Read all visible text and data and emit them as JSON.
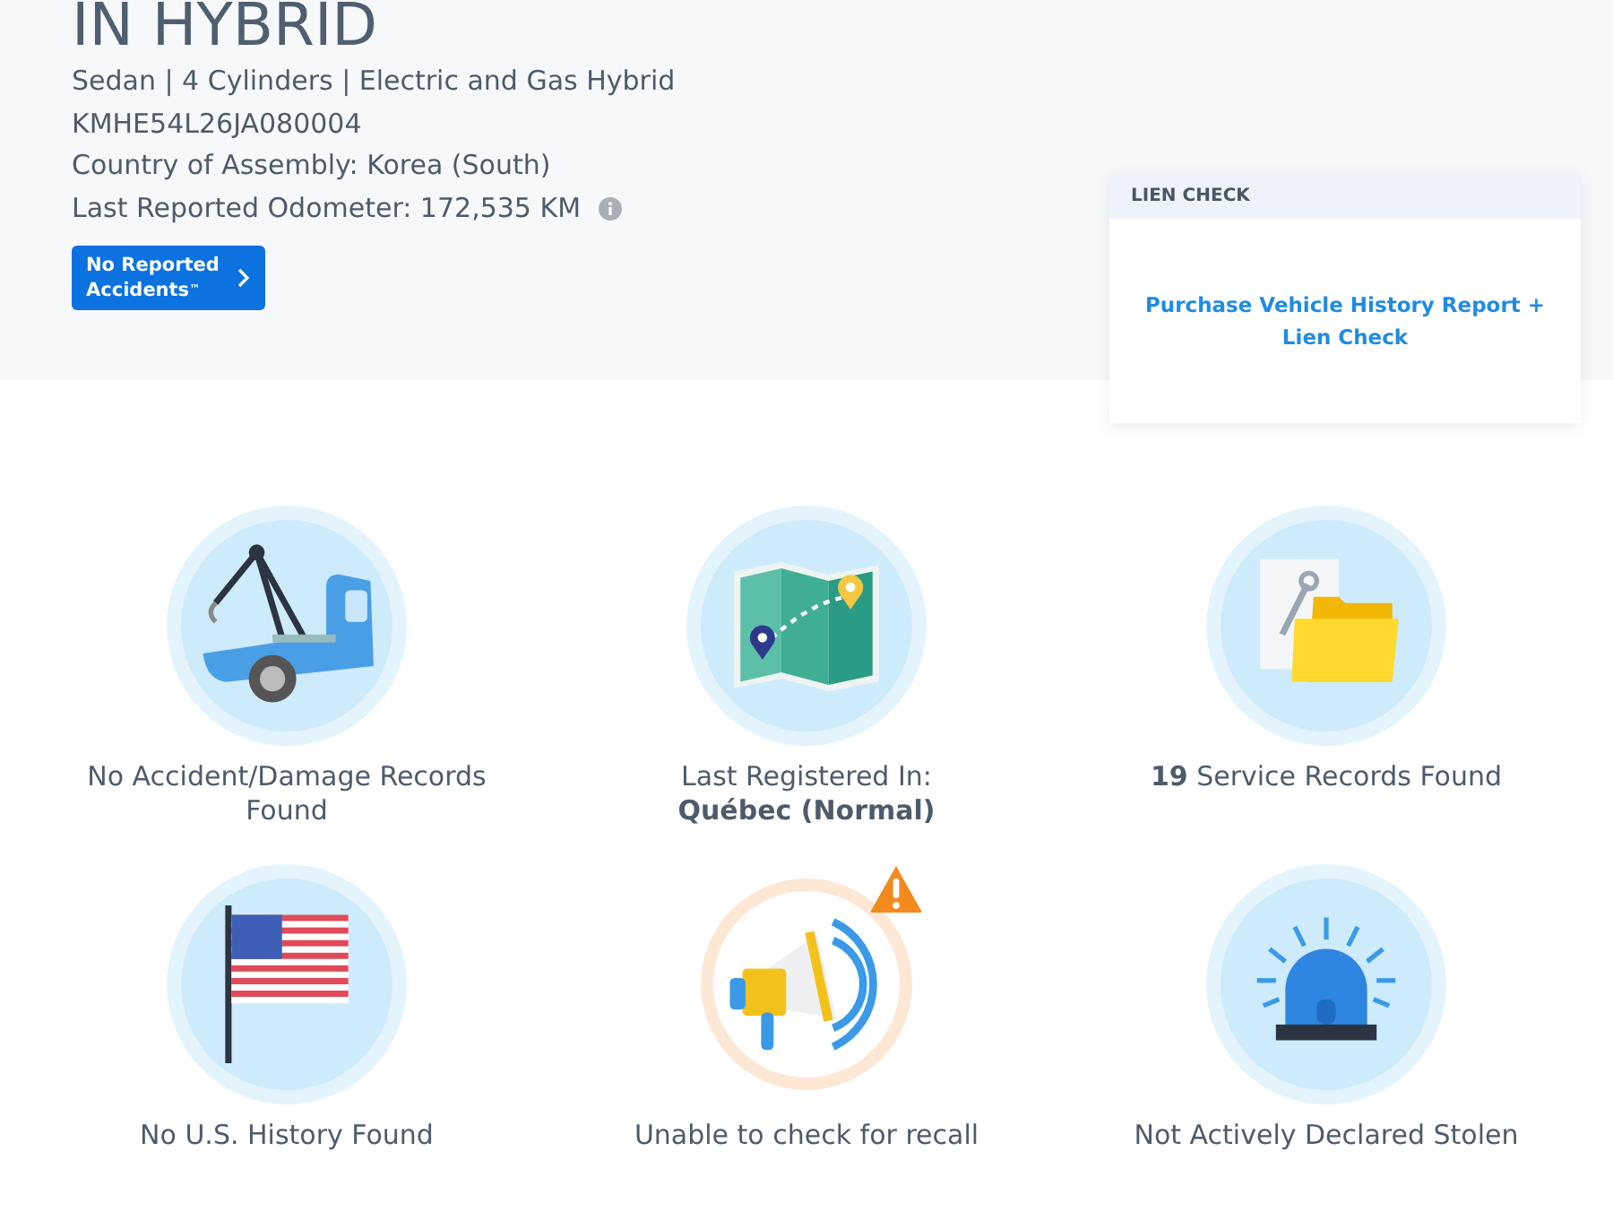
{
  "vehicle": {
    "title": "IN HYBRID",
    "lines": [
      "Sedan | 4 Cylinders | Electric and Gas Hybrid",
      "KMHE54L26JA080004",
      "Country of Assembly: Korea (South)",
      "Last Reported Odometer: 172,535 KM"
    ],
    "badge": {
      "line1": "No Reported",
      "line2": "Accidents",
      "mark": "™"
    }
  },
  "lien_check": {
    "title": "LIEN CHECK",
    "link": "Purchase Vehicle History Report + Lien Check"
  },
  "records": [
    {
      "kind": "truck",
      "text": "No Accident/Damage Records Found",
      "warning": false
    },
    {
      "kind": "map",
      "text": "Last Registered In:\n**Québec (Normal)**",
      "warning": false
    },
    {
      "kind": "folder",
      "text": "**19** Service Records Found",
      "warning": false
    },
    {
      "kind": "flag",
      "text": "No U.S. History Found",
      "warning": false
    },
    {
      "kind": "megaphone",
      "text": "Unable to check for recall",
      "warning": true
    },
    {
      "kind": "siren",
      "text": "Not Actively Declared Stolen",
      "warning": false
    }
  ]
}
